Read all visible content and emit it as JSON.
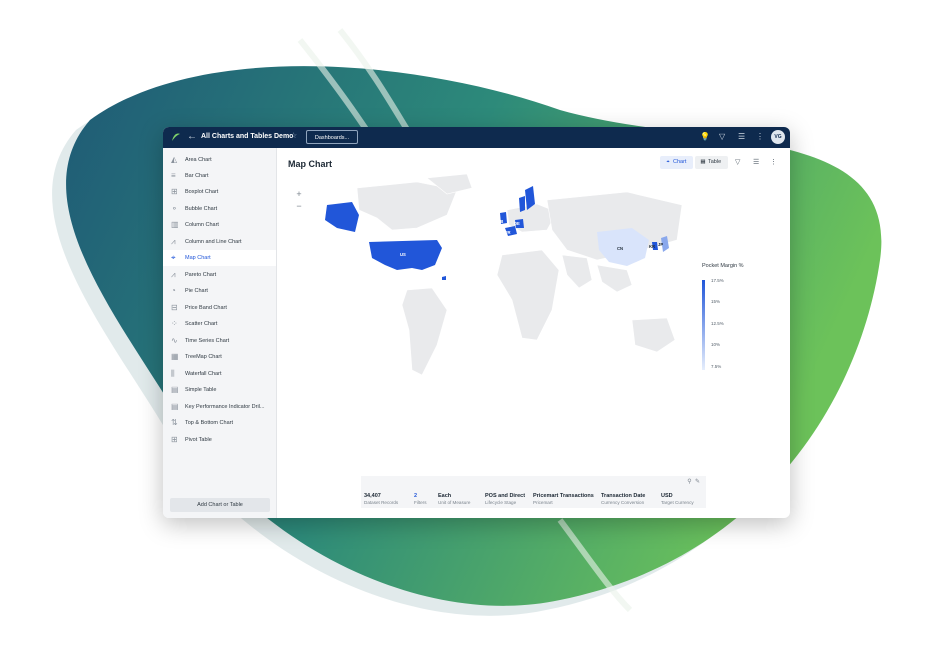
{
  "app": {
    "title": "All Charts and Tables Demo",
    "dashboards_label": "Dashboards...",
    "avatar_initials": "VG",
    "accent_color": "#2156d9",
    "header_color": "#0e2a4e"
  },
  "sidebar": {
    "items": [
      {
        "label": "Area Chart",
        "icon": "area-chart-icon"
      },
      {
        "label": "Bar Chart",
        "icon": "bar-chart-icon"
      },
      {
        "label": "Boxplot Chart",
        "icon": "boxplot-chart-icon"
      },
      {
        "label": "Bubble Chart",
        "icon": "bubble-chart-icon"
      },
      {
        "label": "Column Chart",
        "icon": "column-chart-icon"
      },
      {
        "label": "Column and Line Chart",
        "icon": "column-line-chart-icon"
      },
      {
        "label": "Map Chart",
        "icon": "map-chart-icon",
        "active": true
      },
      {
        "label": "Pareto Chart",
        "icon": "pareto-chart-icon"
      },
      {
        "label": "Pie Chart",
        "icon": "pie-chart-icon"
      },
      {
        "label": "Price Band Chart",
        "icon": "price-band-chart-icon"
      },
      {
        "label": "Scatter Chart",
        "icon": "scatter-chart-icon"
      },
      {
        "label": "Time Series Chart",
        "icon": "time-series-chart-icon"
      },
      {
        "label": "TreeMap Chart",
        "icon": "treemap-chart-icon"
      },
      {
        "label": "Waterfall Chart",
        "icon": "waterfall-chart-icon"
      },
      {
        "label": "Simple Table",
        "icon": "table-icon"
      },
      {
        "label": "Key Performance Indicator Dril...",
        "icon": "kpi-icon"
      },
      {
        "label": "Top & Bottom Chart",
        "icon": "top-bottom-chart-icon"
      },
      {
        "label": "Pivot Table",
        "icon": "pivot-table-icon"
      }
    ],
    "add_label": "Add Chart or Table"
  },
  "main": {
    "title": "Map Chart",
    "tabs": [
      {
        "label": "Chart",
        "active": true
      },
      {
        "label": "Table",
        "active": false
      }
    ],
    "zoom_in": "+",
    "zoom_out": "−"
  },
  "chart_data": {
    "type": "map",
    "legend": {
      "title": "Pocket Margin %",
      "ticks": [
        "17.5%",
        "15%",
        "12.5%",
        "10%",
        "7.5%"
      ],
      "color_high": "#2156d9",
      "color_low": "#e6eefc"
    },
    "regions": [
      {
        "code": "US",
        "label": "US",
        "color": "#2156d9"
      },
      {
        "code": "CA-AK",
        "label": "",
        "color": "#2156d9"
      },
      {
        "code": "CN",
        "label": "CN",
        "color": "#d9e4fb"
      },
      {
        "code": "KR",
        "label": "KR",
        "color": "#2156d9"
      },
      {
        "code": "JP",
        "label": "JP",
        "color": "#8aa8ec"
      },
      {
        "code": "GB",
        "label": "GB",
        "color": "#2156d9"
      },
      {
        "code": "DE",
        "label": "DE",
        "color": "#2156d9"
      },
      {
        "code": "FR",
        "label": "FR",
        "color": "#2156d9"
      },
      {
        "code": "SE",
        "label": "SE",
        "color": "#2156d9"
      }
    ]
  },
  "footer": {
    "items": [
      {
        "value": "34,407",
        "label": "Dataset Records"
      },
      {
        "value": "2",
        "label": "Filters",
        "accent": true
      },
      {
        "value": "Each",
        "label": "Unit of Measure"
      },
      {
        "value": "POS and Direct",
        "label": "Lifecycle Stage"
      },
      {
        "value": "Pricemart Transactions",
        "label": "Pricemart"
      },
      {
        "value": "Transaction Date",
        "label": "Currency Conversion"
      },
      {
        "value": "USD",
        "label": "Target Currency"
      }
    ]
  }
}
